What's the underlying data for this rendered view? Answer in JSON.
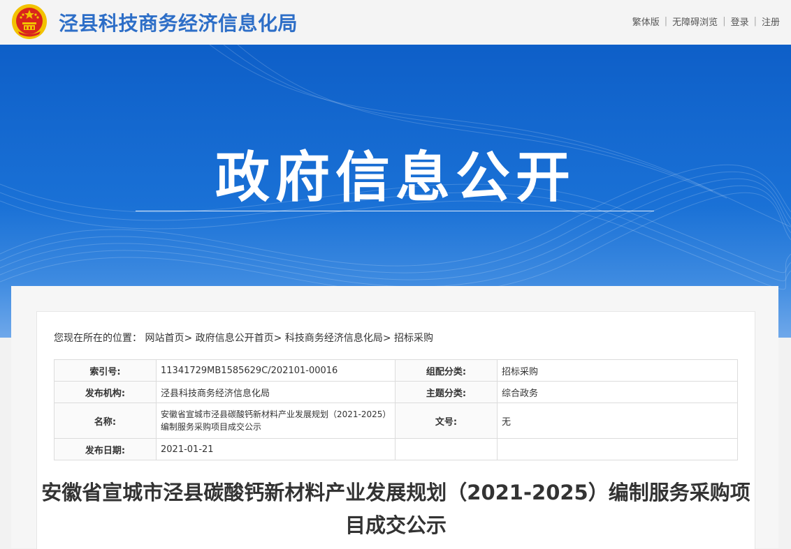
{
  "header": {
    "site_title": "泾县科技商务经济信息化局",
    "links": [
      "繁体版",
      "无障碍浏览",
      "登录",
      "注册"
    ]
  },
  "banner": {
    "title": "政府信息公开"
  },
  "breadcrumb": {
    "prefix": "您现在所在的位置：",
    "items": [
      {
        "label": "网站首页",
        "sep": ">"
      },
      {
        "label": "政府信息公开首页",
        "sep": ">"
      },
      {
        "label": "科技商务经济信息化局",
        "sep": ">"
      },
      {
        "label": "招标采购",
        "sep": ""
      }
    ]
  },
  "meta": {
    "index_label": "索引号:",
    "index_value": "11341729MB1585629C/202101-00016",
    "category_label": "组配分类:",
    "category_value": "招标采购",
    "org_label": "发布机构:",
    "org_value": "泾县科技商务经济信息化局",
    "topic_label": "主题分类:",
    "topic_value": "综合政务",
    "name_label": "名称:",
    "name_value": "安徽省宣城市泾县碳酸钙新材料产业发展规划（2021-2025）编制服务采购项目成交公示",
    "docno_label": "文号:",
    "docno_value": "无",
    "date_label": "发布日期:",
    "date_value": "2021-01-21"
  },
  "article": {
    "title": "安徽省宣城市泾县碳酸钙新材料产业发展规划（2021-2025）编制服务采购项目成交公示"
  },
  "colors": {
    "brand_blue": "#2d6ec7",
    "banner_blue": "#1a71d6",
    "emblem_red": "#d9251c",
    "emblem_gold": "#f2c200"
  }
}
